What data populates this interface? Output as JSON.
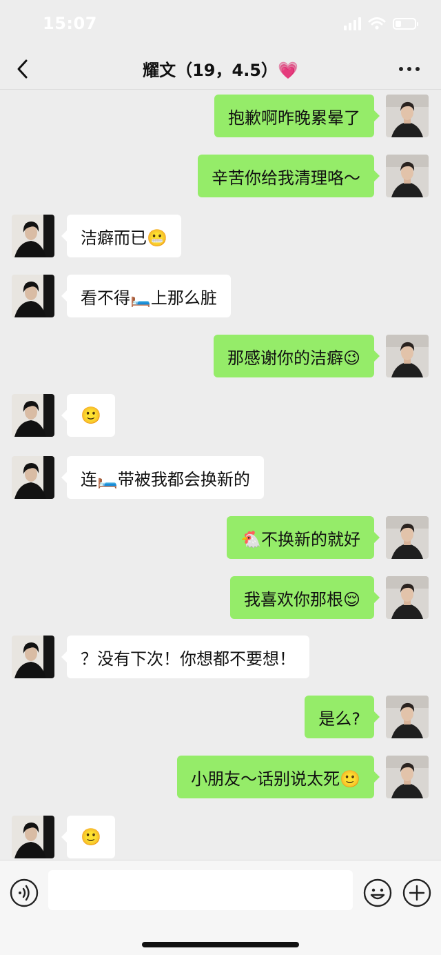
{
  "status_bar": {
    "time": "15:07"
  },
  "header": {
    "title": "耀文（19，4.5）💗",
    "back_icon": "chevron-left-icon",
    "more_icon": "more-horizontal-icon"
  },
  "messages": [
    {
      "side": "right",
      "text": "抱歉啊昨晚累晕了"
    },
    {
      "side": "right",
      "text": "辛苦你给我清理咯～"
    },
    {
      "side": "left",
      "text": "洁癖而已😬"
    },
    {
      "side": "left",
      "text": "看不得🛏️上那么脏"
    },
    {
      "side": "right",
      "text": "那感谢你的洁癖😉"
    },
    {
      "side": "left",
      "text": "🙂"
    },
    {
      "side": "left",
      "text": "连🛏️带被我都会换新的"
    },
    {
      "side": "right",
      "text": "🐔不换新的就好"
    },
    {
      "side": "right",
      "text": "我喜欢你那根😌"
    },
    {
      "side": "left",
      "text": "？没有下次！你想都不要想！"
    },
    {
      "side": "right",
      "text": "是么?"
    },
    {
      "side": "right",
      "text": "小朋友～话别说太死🙂"
    },
    {
      "side": "left",
      "text": "🙂"
    }
  ],
  "input_bar": {
    "placeholder": "",
    "voice_icon": "voice-icon",
    "emoji_icon": "emoji-icon",
    "plus_icon": "plus-icon"
  },
  "colors": {
    "background": "#ededed",
    "my_bubble": "#95ec69",
    "their_bubble": "#ffffff"
  }
}
